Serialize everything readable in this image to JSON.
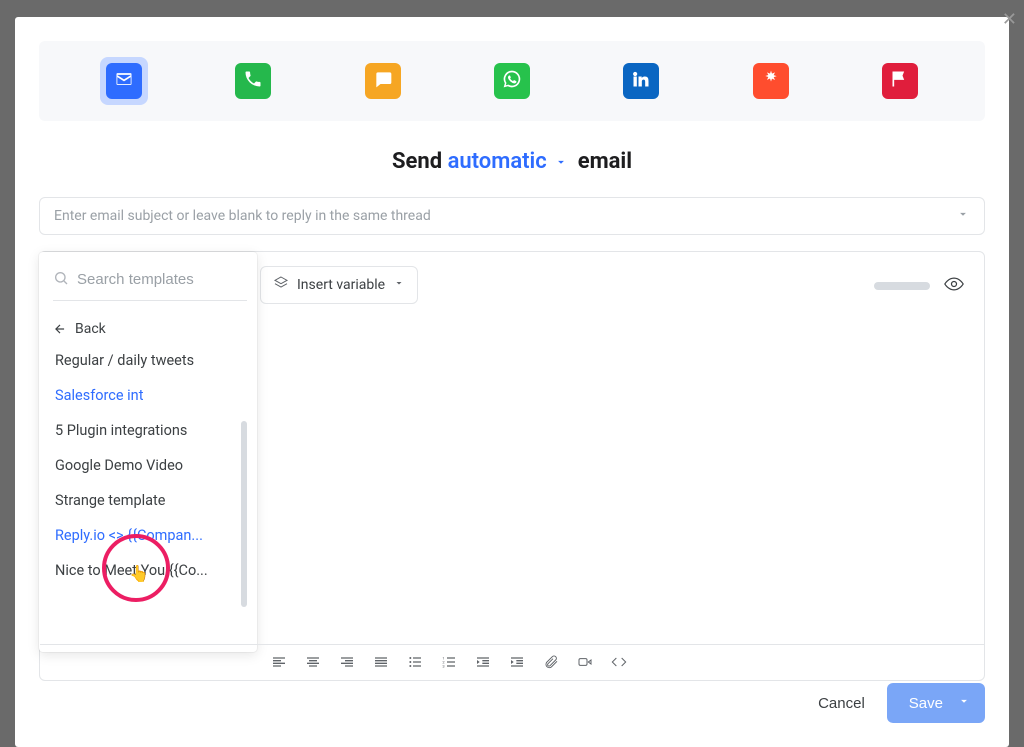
{
  "channels": {
    "email": "email-icon",
    "call": "phone-icon",
    "chat": "chat-icon",
    "whatsapp": "whatsapp-icon",
    "linkedin": "linkedin-icon",
    "zapier": "zapier-icon",
    "task": "flag-icon"
  },
  "headline": {
    "prefix": "Send ",
    "mode": "automatic",
    "suffix": " email"
  },
  "subject": {
    "placeholder": "Enter email subject or leave blank to reply in the same thread"
  },
  "toolbar": {
    "insert_variable_label": "Insert variable"
  },
  "templates": {
    "search_placeholder": "Search templates",
    "back_label": "Back",
    "items": [
      {
        "label": "Regular / daily tweets",
        "accent": false
      },
      {
        "label": "Salesforce int",
        "accent": true
      },
      {
        "label": "5 Plugin integrations",
        "accent": false
      },
      {
        "label": "Google Demo Video",
        "accent": false
      },
      {
        "label": "Strange template",
        "accent": false
      },
      {
        "label": "Reply.io <> {{Compan...",
        "accent": true
      },
      {
        "label": "Nice to Meet You {{Co...",
        "accent": false
      }
    ]
  },
  "footer": {
    "cancel_label": "Cancel",
    "save_label": "Save"
  }
}
